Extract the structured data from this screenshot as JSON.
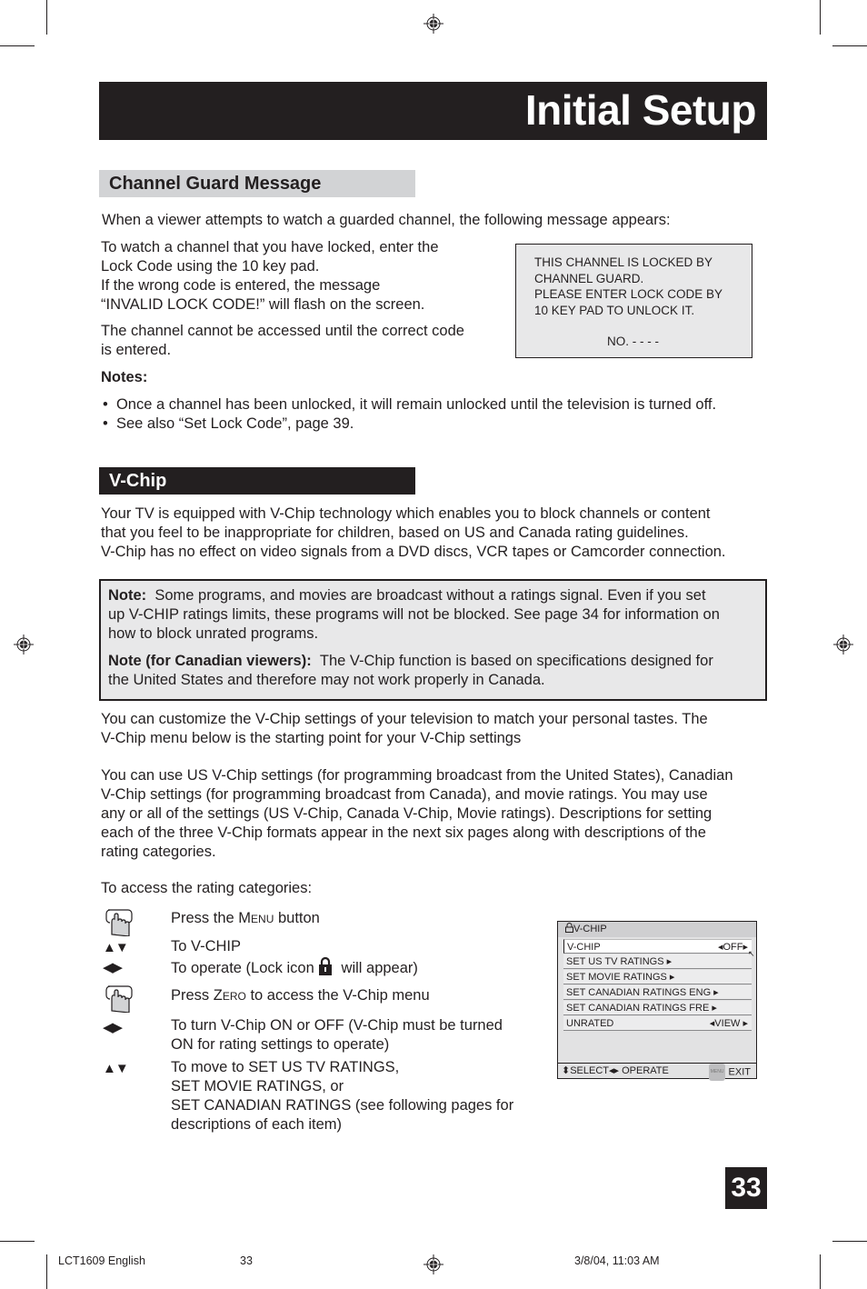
{
  "header": {
    "title": "Initial Setup"
  },
  "channel_guard": {
    "heading": "Channel Guard Message",
    "intro": "When a viewer attempts to watch a guarded channel, the following message appears:",
    "para1_lines": [
      "To watch a channel that you have locked, enter the",
      "Lock Code using the 10 key pad.",
      "If the wrong code is entered, the message",
      "“INVALID LOCK CODE!” will flash on the screen."
    ],
    "para2_lines": [
      "The channel cannot be accessed until the correct code",
      "is entered."
    ],
    "lock_message": {
      "lines": [
        "THIS CHANNEL IS LOCKED BY",
        "CHANNEL GUARD.",
        "PLEASE ENTER LOCK CODE BY",
        "10 KEY PAD TO UNLOCK IT."
      ],
      "code_line": "NO. - - - -"
    },
    "notes_label": "Notes:",
    "notes": [
      "Once a channel has been unlocked, it will remain unlocked until the television is turned off.",
      "See also “Set Lock Code”, page 39."
    ]
  },
  "vchip": {
    "heading": "V-Chip",
    "intro_lines": [
      "Your TV is equipped with V-Chip technology which enables you to block channels or content",
      "that you feel to be inappropriate for children, based on US and Canada rating guidelines.",
      "V-Chip has no effect on video signals from a DVD discs, VCR tapes or Camcorder connection."
    ],
    "note_box": {
      "note1_label": "Note:",
      "note1_lines": [
        "Some programs, and movies are broadcast without a ratings signal. Even if you set",
        "up V-CHIP ratings limits, these programs will not be blocked. See page 34 for information on",
        "how to block unrated programs."
      ],
      "note2_label": "Note (for Canadian viewers):",
      "note2_lines": [
        "The V-Chip function is based on specifications designed for",
        "the United States and therefore may not work properly in Canada."
      ]
    },
    "customize_lines": [
      "You can customize the V-Chip settings of your television to match your personal tastes. The",
      "V-Chip menu below is the starting point for your V-Chip settings"
    ],
    "settings_lines": [
      "You can use US V-Chip settings (for programming broadcast from the United States), Canadian",
      "V-Chip settings (for programming broadcast from Canada), and movie ratings. You may use",
      "any or all of the settings (US V-Chip, Canada V-Chip, Movie ratings). Descriptions for setting",
      "each of the three V-Chip formats appear in the next six pages along with descriptions of the",
      "rating categories."
    ],
    "access_label": "To access the rating categories:",
    "steps": [
      {
        "icon": "hand-press-icon",
        "lines": [
          "Press the ",
          "Menu",
          " button"
        ]
      },
      {
        "icon": "up-down-arrows-icon",
        "glyph": "▲▼",
        "text": "To V-CHIP"
      },
      {
        "icon": "left-right-arrows-icon",
        "glyph": "◀▶",
        "text_before": "To operate (Lock icon",
        "text_after": "will appear)"
      },
      {
        "icon": "hand-press-icon",
        "lines": [
          "Press ",
          "Zero",
          " to access the V-Chip menu"
        ]
      },
      {
        "icon": "left-right-arrows-icon",
        "glyph": "◀▶",
        "lines": [
          "To turn V-Chip ON or OFF (V-Chip must be turned",
          "ON for rating settings to operate)"
        ]
      },
      {
        "icon": "up-down-arrows-icon",
        "glyph": "▲▼",
        "lines": [
          "To move to SET US TV RATINGS,",
          "SET MOVIE RATINGS, or",
          "SET CANADIAN RATINGS (see following pages for",
          "descriptions of each item)"
        ]
      }
    ],
    "menu": {
      "title": "V-CHIP",
      "rows": [
        {
          "label": "V-CHIP",
          "value": "◂OFF▸"
        },
        {
          "label": "SET US TV RATINGS ▸",
          "value": ""
        },
        {
          "label": "SET MOVIE RATINGS ▸",
          "value": ""
        },
        {
          "label": "SET CANADIAN RATINGS ENG ▸",
          "value": ""
        },
        {
          "label": "SET CANADIAN RATINGS FRE ▸",
          "value": ""
        },
        {
          "label": "UNRATED",
          "value": "◂VIEW ▸"
        }
      ],
      "footer_select": "⬍SELECT",
      "footer_operate": "◂▸ OPERATE",
      "footer_menu_badge": "MENU",
      "footer_exit": "EXIT"
    }
  },
  "page_number": "33",
  "footer": {
    "doc": "LCT1609 English",
    "page": "33",
    "timestamp": "3/8/04, 11:03 AM"
  }
}
